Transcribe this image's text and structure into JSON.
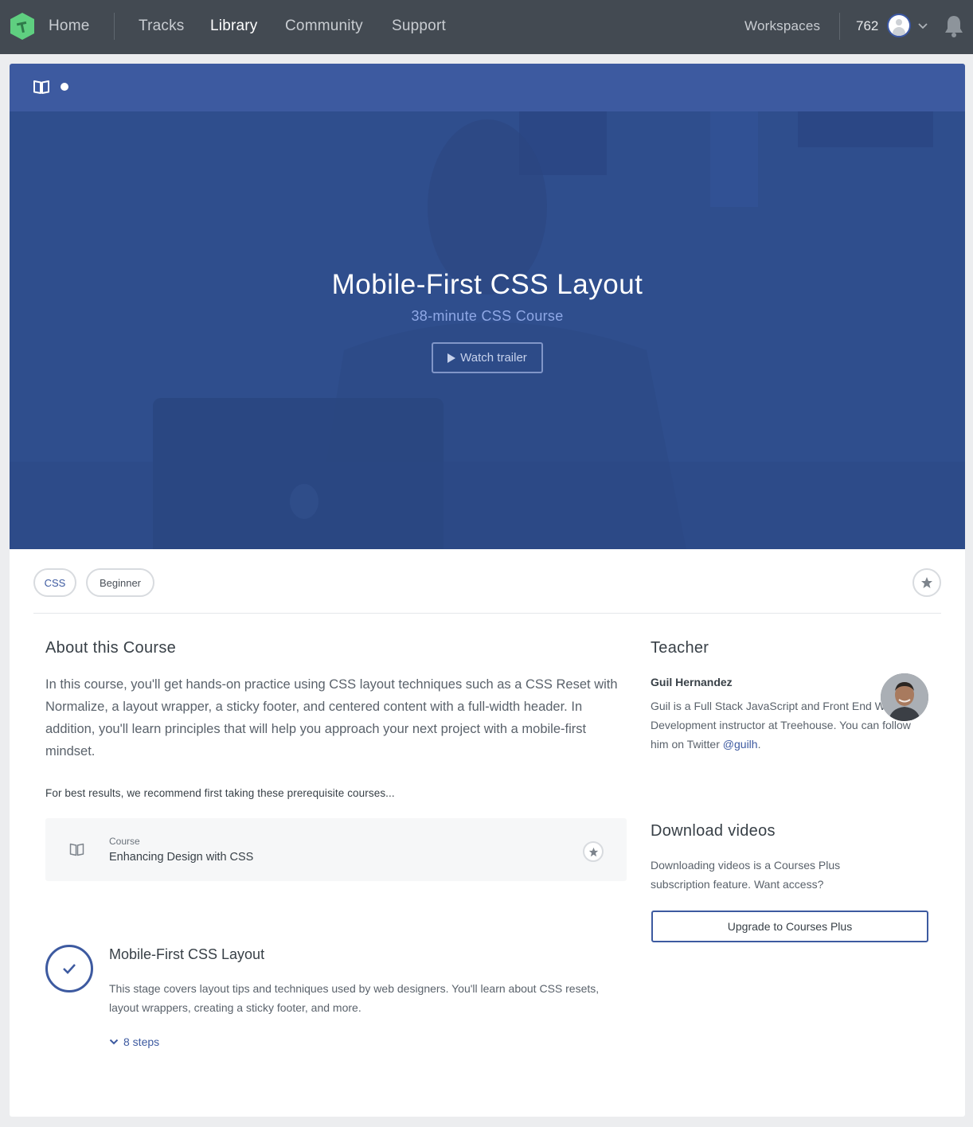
{
  "nav": {
    "home": "Home",
    "tracks": "Tracks",
    "library": "Library",
    "community": "Community",
    "support": "Support",
    "workspaces": "Workspaces",
    "points": "762"
  },
  "hero": {
    "title": "Mobile-First CSS Layout",
    "subtitle": "38-minute CSS Course",
    "trailer_label": "Watch trailer"
  },
  "tags": [
    "CSS",
    "Beginner"
  ],
  "about": {
    "heading": "About this Course",
    "text": "In this course, you'll get hands-on practice using CSS layout techniques such as a CSS Reset with Normalize, a layout wrapper, a sticky footer, and centered content with a full-width header. In addition, you'll learn principles that will help you approach your next project with a mobile-first mindset.",
    "prereq_label": "For best results, we recommend first taking these prerequisite courses..."
  },
  "prereq": {
    "type": "Course",
    "title": "Enhancing Design with CSS"
  },
  "stage": {
    "title": "Mobile-First CSS Layout",
    "description": "This stage covers layout tips and techniques used by web designers. You'll learn about CSS resets, layout wrappers, creating a sticky footer, and more.",
    "steps": "8 steps"
  },
  "teacher": {
    "heading": "Teacher",
    "name": "Guil Hernandez",
    "bio": "Guil is a Full Stack JavaScript and Front End Web Development instructor at Treehouse. You can follow him on Twitter",
    "handle": "@guilh",
    "bio_end": "."
  },
  "download": {
    "heading": "Download videos",
    "text": "Downloading videos is a Courses Plus subscription feature. Want access?",
    "button": "Upgrade to Courses Plus"
  },
  "colors": {
    "nav_bg": "#434a52",
    "accent": "#3d5aa0",
    "hero_bg": "#2f4d8f",
    "logo_green": "#5fcf80"
  },
  "icons": {
    "logo": "treehouse-logo-icon",
    "book": "book-icon",
    "chevron": "chevron-down-icon",
    "bell": "bell-icon",
    "star": "star-icon",
    "check": "check-icon",
    "play": "play-icon"
  }
}
